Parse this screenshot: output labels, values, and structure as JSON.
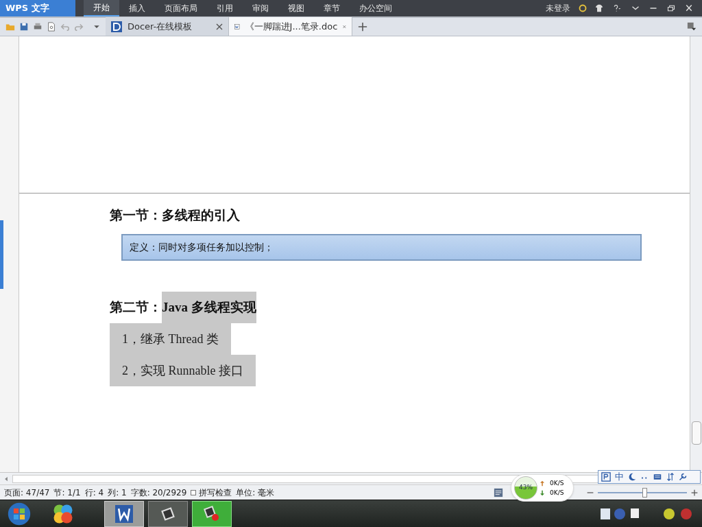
{
  "app_button": {
    "label": "WPS 文字"
  },
  "menu_tabs": [
    {
      "label": "开始",
      "selected": true
    },
    {
      "label": "插入",
      "selected": false
    },
    {
      "label": "页面布局",
      "selected": false
    },
    {
      "label": "引用",
      "selected": false
    },
    {
      "label": "审阅",
      "selected": false
    },
    {
      "label": "视图",
      "selected": false
    },
    {
      "label": "章节",
      "selected": false
    },
    {
      "label": "办公空间",
      "selected": false
    }
  ],
  "login": "未登录",
  "doc_tabs": [
    {
      "label": "Docer-在线模板",
      "selected": false,
      "kind": "docer"
    },
    {
      "label": "《一脚踹进J...笔录.doc",
      "selected": true,
      "kind": "word"
    }
  ],
  "document": {
    "heading_1": [
      {
        "text": "第一节：多线程的引入",
        "selected": false
      }
    ],
    "definition": "定义：同时对多项任务加以控制；",
    "heading_2": [
      {
        "text": "第二节：",
        "selected": false
      },
      {
        "text": "Java 多线程实现",
        "selected": true
      }
    ],
    "list": [
      {
        "text": "1，继承 Thread 类",
        "selected": true
      },
      {
        "text": "2，实现 Runnable 接口",
        "selected": true
      }
    ]
  },
  "status_bar": [
    "页面: 47/47",
    "节: 1/1",
    "行: 4",
    "列: 1",
    "字数: 20/2929",
    "拼写检查",
    "单位: 毫米"
  ],
  "spell_check": {
    "checked": false
  },
  "zoom": {
    "level": 0.52
  },
  "net_widget": {
    "percent": "43%",
    "up": "0K/S",
    "down": "0K/S"
  },
  "ime_toolbar": {
    "mode": "中"
  }
}
